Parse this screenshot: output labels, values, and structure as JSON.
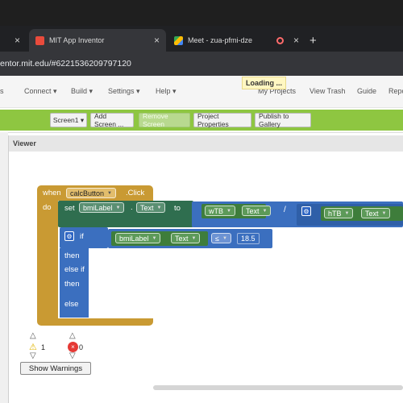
{
  "browser": {
    "tabs": [
      {
        "title": "MIT App Inventor",
        "active": true
      },
      {
        "title": "Meet - zua-pfmi-dze",
        "active": false
      }
    ],
    "url": "entor.mit.edu/#6221536209797120"
  },
  "app": {
    "nav_items": [
      "s",
      "Connect",
      "Build",
      "Settings",
      "Help",
      "My Projects",
      "View Trash",
      "Guide",
      "Repo"
    ],
    "loading_text": "Loading ...",
    "toolbar_buttons": [
      {
        "label": "Screen1",
        "dropdown": true
      },
      {
        "label": "Add Screen ...",
        "dropdown": false
      },
      {
        "label": "Remove Screen",
        "dropdown": false,
        "disabled": true
      },
      {
        "label": "Project Properties",
        "dropdown": false
      },
      {
        "label": "Publish to Gallery",
        "dropdown": false
      }
    ],
    "viewer_title": "Viewer"
  },
  "blocks": {
    "when": "when",
    "component": "calcButton",
    "event": ".Click",
    "do": "do",
    "set": "set",
    "set_component": "bmiLabel",
    "set_prop": "Text",
    "to": "to",
    "w_component": "wTB",
    "w_prop": "Text",
    "divide": "/",
    "h_component": "hTB",
    "h_prop": "Text",
    "if": "if",
    "cond_component": "bmiLabel",
    "cond_prop": "Text",
    "compare": "≤",
    "number": "18.5",
    "then": "then",
    "else_if": "else if",
    "then2": "then",
    "else": "else"
  },
  "status": {
    "warnings": "1",
    "errors": "0",
    "show_warnings_label": "Show Warnings"
  },
  "colors": {
    "event_block": "#c99a33",
    "set_block": "#2f6e4f",
    "get_block": "#3e7d3b",
    "math_block": "#3b6fbf",
    "control_block": "#c99a33",
    "toolbar_green": "#8ec641"
  }
}
